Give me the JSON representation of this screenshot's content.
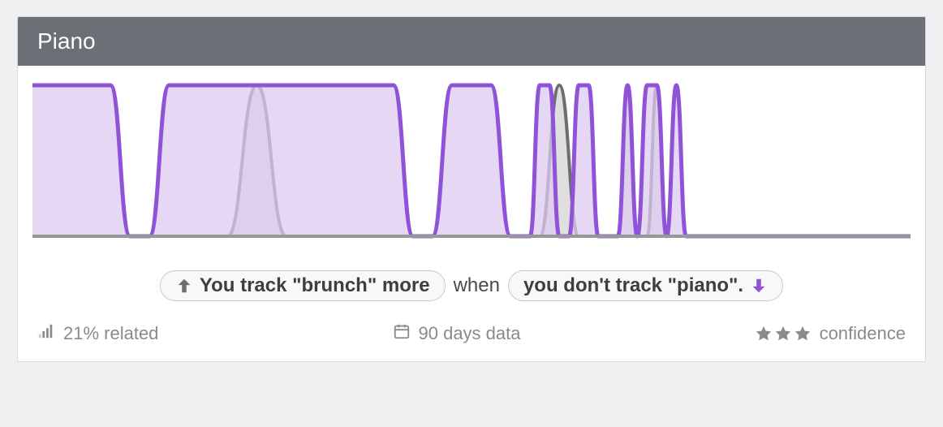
{
  "header": {
    "title": "Piano"
  },
  "insight": {
    "left_pill": "You track \"brunch\" more",
    "middle": "when",
    "right_pill": "you don't track \"piano\"."
  },
  "footer": {
    "related": "21% related",
    "range": "90 days data",
    "confidence_label": "confidence",
    "confidence_stars": 3
  },
  "colors": {
    "primary_stroke": "#8e53d6",
    "primary_fill": "#ddc9f0",
    "secondary_stroke": "#6e6e6e",
    "secondary_fill": "#dcdcdc",
    "baseline": "#979797",
    "icon_gray": "#8a8a8e",
    "arrow_gray": "#6e6e6e"
  },
  "chart_data": {
    "type": "line",
    "title": "Piano",
    "xlabel": "",
    "ylabel": "",
    "ylim": [
      0,
      1
    ],
    "x_range": [
      0,
      90
    ],
    "series": [
      {
        "name": "piano",
        "color": "#8e53d6",
        "values": [
          [
            0,
            1
          ],
          [
            8,
            1
          ],
          [
            10,
            0
          ],
          [
            12,
            0
          ],
          [
            14,
            1
          ],
          [
            37,
            1
          ],
          [
            39,
            0
          ],
          [
            41,
            0
          ],
          [
            43,
            1
          ],
          [
            47,
            1
          ],
          [
            49,
            0
          ],
          [
            51,
            0
          ],
          [
            52,
            1
          ],
          [
            53,
            1
          ],
          [
            54,
            0
          ],
          [
            55,
            0
          ],
          [
            56,
            1
          ],
          [
            57,
            1
          ],
          [
            58,
            0
          ],
          [
            60,
            0
          ],
          [
            61,
            1
          ],
          [
            62,
            0
          ],
          [
            63,
            1
          ],
          [
            64,
            1
          ],
          [
            65,
            0
          ],
          [
            66,
            1
          ],
          [
            67,
            0
          ],
          [
            68,
            0
          ],
          [
            90,
            0
          ]
        ]
      },
      {
        "name": "brunch",
        "color": "#6e6e6e",
        "values": [
          [
            0,
            0
          ],
          [
            20,
            0
          ],
          [
            23,
            1
          ],
          [
            26,
            0
          ],
          [
            52,
            0
          ],
          [
            54,
            1
          ],
          [
            56,
            0
          ],
          [
            60,
            0
          ],
          [
            61,
            1
          ],
          [
            62,
            0
          ],
          [
            63,
            0
          ],
          [
            64,
            1
          ],
          [
            65,
            0
          ],
          [
            90,
            0
          ]
        ]
      }
    ]
  }
}
